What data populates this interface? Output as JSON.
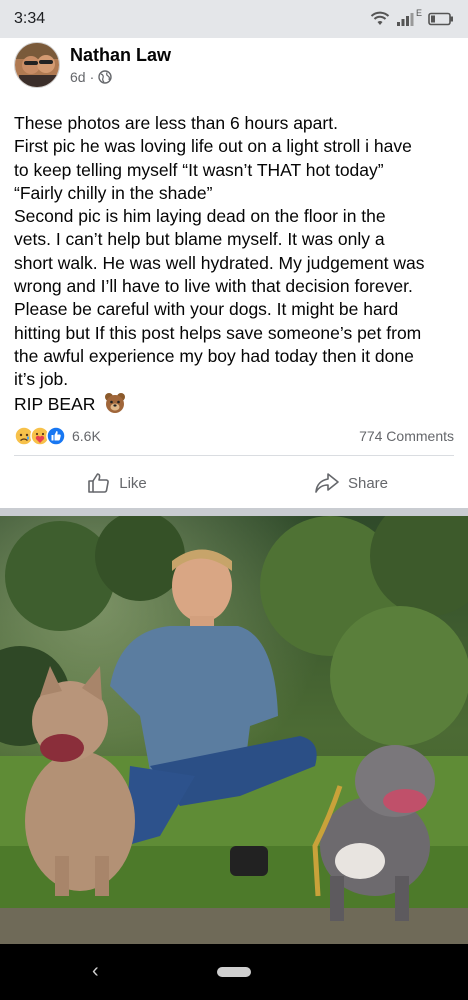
{
  "status_bar": {
    "time": "3:34",
    "network_label": "E",
    "icons": [
      "wifi-icon",
      "signal-icon",
      "battery-icon"
    ]
  },
  "post": {
    "author": "Nathan Law",
    "time_ago": "6d",
    "meta_separator": "·",
    "privacy_icon": "globe-icon",
    "text_lines": [
      "These photos are less than 6 hours apart.",
      "First pic he was loving life out on a light stroll i have",
      "to keep telling myself “It wasn’t THAT hot today”",
      "“Fairly chilly in the shade”",
      "Second pic is him laying dead on the floor in the",
      "vets. I can’t help but blame myself. It was only a",
      "short walk. He was well hydrated. My judgement was",
      "wrong and I’ll have to live with that decision forever.",
      "Please be careful with your dogs. It might be hard",
      "hitting but If this post helps save someone’s pet from",
      "the awful experience my boy had today then it done",
      "it’s job.",
      "RIP BEAR"
    ],
    "emoji_icon": "bear-face-icon",
    "reactions": {
      "icons": [
        "sad-icon",
        "care-icon",
        "like-icon"
      ],
      "count": "6.6K"
    },
    "comments": "774 Comments",
    "actions": {
      "like": "Like",
      "share": "Share"
    }
  },
  "colors": {
    "status_bar_bg": "#e4e6e9",
    "muted_text": "#65676b",
    "like_blue": "#1877f2",
    "separator": "#c9ccd1"
  }
}
